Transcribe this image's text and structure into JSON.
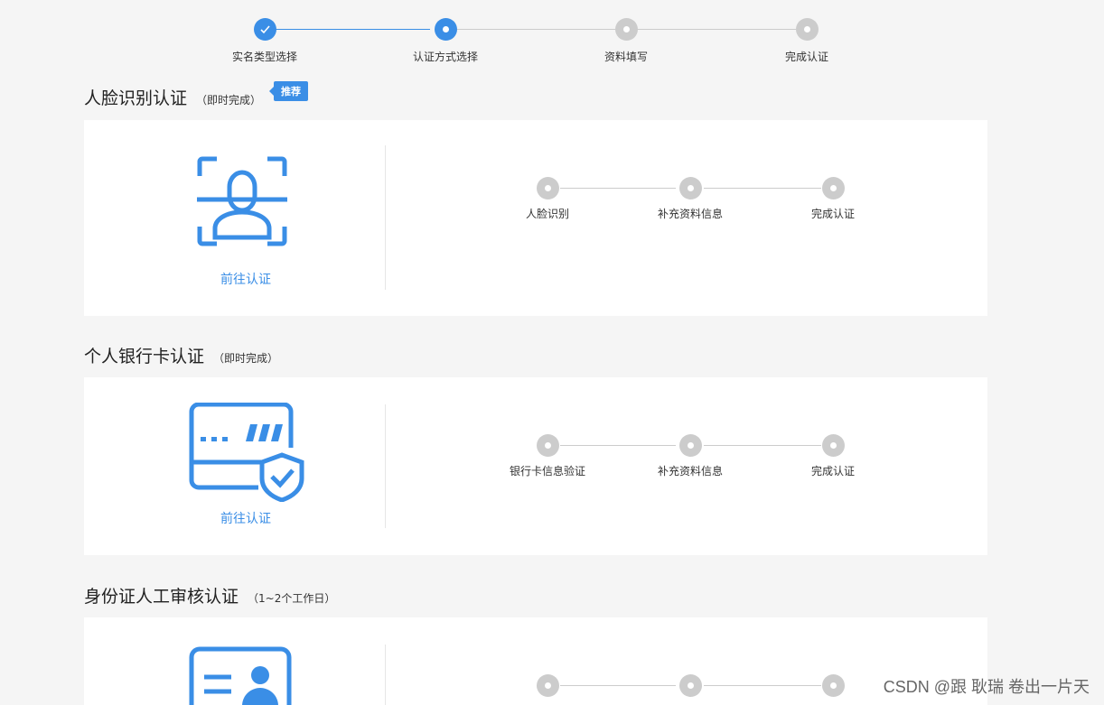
{
  "top_steps": [
    {
      "label": "实名类型选择",
      "state": "done"
    },
    {
      "label": "认证方式选择",
      "state": "active"
    },
    {
      "label": "资料填写",
      "state": "pending"
    },
    {
      "label": "完成认证",
      "state": "pending"
    }
  ],
  "sections": [
    {
      "title": "人脸识别认证",
      "subtitle": "（即时完成）",
      "badge": "推荐",
      "icon": "face-scan-icon",
      "link": "前往认证",
      "steps": [
        "人脸识别",
        "补充资料信息",
        "完成认证"
      ]
    },
    {
      "title": "个人银行卡认证",
      "subtitle": "（即时完成）",
      "icon": "bank-card-shield-icon",
      "link": "前往认证",
      "steps": [
        "银行卡信息验证",
        "补充资料信息",
        "完成认证"
      ]
    },
    {
      "title": "身份证人工审核认证",
      "subtitle": "（1~2个工作日）",
      "icon": "id-card-icon",
      "steps": [
        "",
        "",
        ""
      ]
    }
  ],
  "watermark": "CSDN @跟 耿瑞 卷出一片天",
  "colors": {
    "accent": "#3a8ee6",
    "inactive": "#cccccc",
    "background": "#f5f5f5"
  }
}
